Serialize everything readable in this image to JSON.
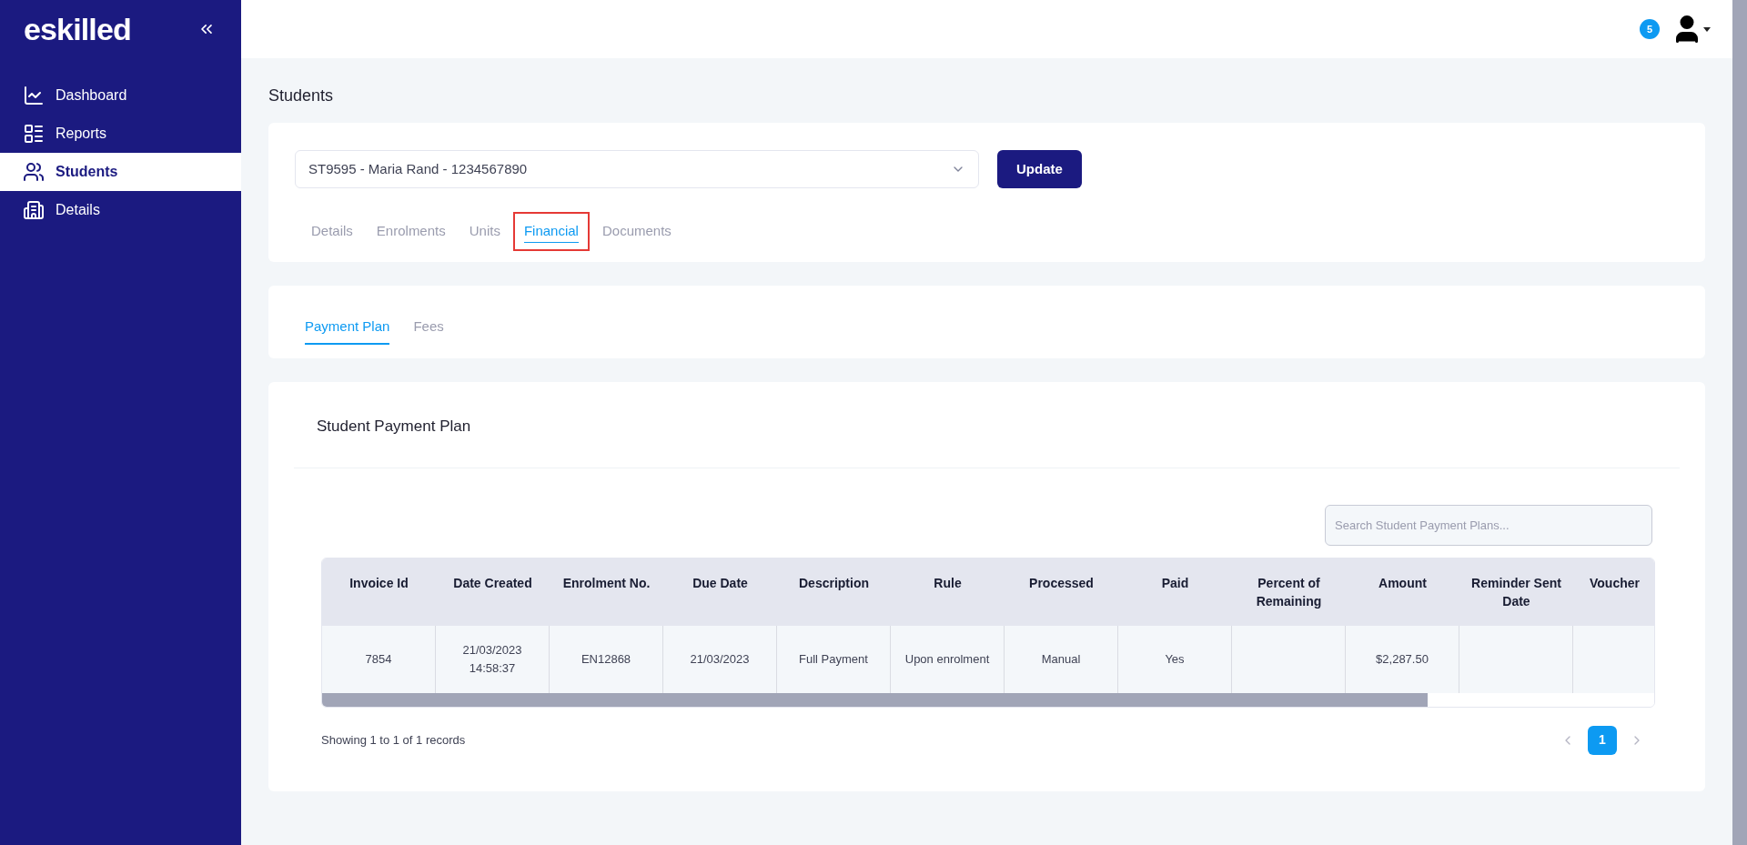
{
  "sidebar": {
    "logo": "eskilled",
    "items": [
      {
        "label": "Dashboard",
        "selected": false
      },
      {
        "label": "Reports",
        "selected": false
      },
      {
        "label": "Students",
        "selected": true
      },
      {
        "label": "Details",
        "selected": false
      }
    ]
  },
  "header": {
    "notifications": "5"
  },
  "page_title": "Students",
  "student_select": {
    "value": "ST9595 - Maria Rand - 1234567890"
  },
  "update_button": "Update",
  "tabs": [
    {
      "label": "Details",
      "selected": false,
      "highlighted": false
    },
    {
      "label": "Enrolments",
      "selected": false,
      "highlighted": false
    },
    {
      "label": "Units",
      "selected": false,
      "highlighted": false
    },
    {
      "label": "Financial",
      "selected": true,
      "highlighted": true
    },
    {
      "label": "Documents",
      "selected": false,
      "highlighted": false
    }
  ],
  "subtabs": [
    {
      "label": "Payment Plan",
      "selected": true
    },
    {
      "label": "Fees",
      "selected": false
    }
  ],
  "panel": {
    "title": "Student Payment Plan",
    "search": {
      "placeholder": "Search Student Payment Plans..."
    },
    "table": {
      "columns": [
        "Invoice Id",
        "Date Created",
        "Enrolment No.",
        "Due Date",
        "Description",
        "Rule",
        "Processed",
        "Paid",
        "Percent of Remaining",
        "Amount",
        "Reminder Sent Date",
        "Voucher"
      ],
      "rows": [
        {
          "cells": [
            "7854",
            "21/03/2023 14:58:37",
            "EN12868",
            "21/03/2023",
            "Full Payment",
            "Upon enrolment",
            "Manual",
            "Yes",
            null,
            "$2,287.50",
            null,
            null
          ]
        }
      ]
    },
    "summary": "Showing 1 to 1 of 1 records",
    "pages": [
      {
        "label": "1",
        "selected": true
      }
    ]
  }
}
